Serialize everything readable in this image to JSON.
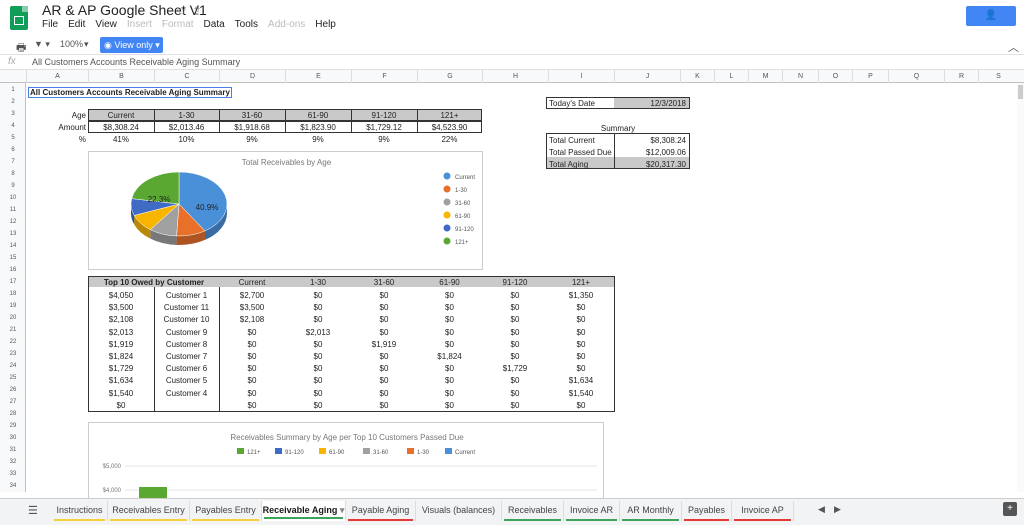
{
  "app": {
    "title": "AR & AP Google Sheet V1",
    "share_label": "SHARE",
    "menus": [
      "File",
      "Edit",
      "View",
      "Insert",
      "Format",
      "Data",
      "Tools",
      "Add-ons",
      "Help"
    ],
    "disabled_menus": [
      "Insert",
      "Format",
      "Add-ons"
    ]
  },
  "toolbar": {
    "zoom": "100%",
    "view_only": "View only"
  },
  "formula": {
    "fx": "fx",
    "text": "All Customers Accounts Receivable Aging Summary"
  },
  "columns": [
    "A",
    "B",
    "C",
    "D",
    "E",
    "F",
    "G",
    "H",
    "I",
    "J",
    "K",
    "L",
    "M",
    "N",
    "O",
    "P",
    "Q",
    "R",
    "S"
  ],
  "rows": [
    "1",
    "2",
    "3",
    "4",
    "5",
    "6",
    "7",
    "8",
    "9",
    "10",
    "11",
    "12",
    "13",
    "14",
    "15",
    "16",
    "17",
    "18",
    "19",
    "20",
    "21",
    "22",
    "23",
    "24",
    "25",
    "26",
    "27",
    "28",
    "29",
    "30",
    "31",
    "32",
    "33",
    "34"
  ],
  "sheet": {
    "heading": "All Customers Accounts Receivable Aging Summary",
    "age_label": "Age",
    "amount_label": "Amount",
    "pct_label": "%",
    "age_headers": [
      "Current",
      "1-30",
      "31-60",
      "61-90",
      "91-120",
      "121+"
    ],
    "amounts": [
      "$8,308.24",
      "$2,013.46",
      "$1,918.68",
      "$1,823.90",
      "$1,729.12",
      "$4,523.90"
    ],
    "percents": [
      "41%",
      "10%",
      "9%",
      "9%",
      "9%",
      "22%"
    ],
    "todays_date_label": "Today's Date",
    "todays_date": "12/3/2018",
    "summary_title": "Summary",
    "summary": [
      {
        "label": "Total Current",
        "value": "$8,308.24"
      },
      {
        "label": "Total Passed Due",
        "value": "$12,009.06"
      },
      {
        "label": "Total Aging",
        "value": "$20,317.30"
      }
    ],
    "top10_header": "Top 10 Owed by Customer",
    "top10_cols": [
      "Current",
      "1-30",
      "31-60",
      "61-90",
      "91-120",
      "121+"
    ],
    "top10": [
      [
        "$4,050",
        "Customer 1",
        "$2,700",
        "$0",
        "$0",
        "$0",
        "$0",
        "$1,350"
      ],
      [
        "$3,500",
        "Customer 11",
        "$3,500",
        "$0",
        "$0",
        "$0",
        "$0",
        "$0"
      ],
      [
        "$2,108",
        "Customer 10",
        "$2,108",
        "$0",
        "$0",
        "$0",
        "$0",
        "$0"
      ],
      [
        "$2,013",
        "Customer 9",
        "$0",
        "$2,013",
        "$0",
        "$0",
        "$0",
        "$0"
      ],
      [
        "$1,919",
        "Customer 8",
        "$0",
        "$0",
        "$1,919",
        "$0",
        "$0",
        "$0"
      ],
      [
        "$1,824",
        "Customer 7",
        "$0",
        "$0",
        "$0",
        "$1,824",
        "$0",
        "$0"
      ],
      [
        "$1,729",
        "Customer 6",
        "$0",
        "$0",
        "$0",
        "$0",
        "$1,729",
        "$0"
      ],
      [
        "$1,634",
        "Customer 5",
        "$0",
        "$0",
        "$0",
        "$0",
        "$0",
        "$1,634"
      ],
      [
        "$1,540",
        "Customer 4",
        "$0",
        "$0",
        "$0",
        "$0",
        "$0",
        "$1,540"
      ],
      [
        "$0",
        "",
        "$0",
        "$0",
        "$0",
        "$0",
        "$0",
        "$0"
      ]
    ]
  },
  "chart_data": [
    {
      "type": "pie",
      "title": "Total Receivables by Age",
      "categories": [
        "Current",
        "1-30",
        "31-60",
        "61-90",
        "91-120",
        "121+"
      ],
      "values": [
        40.9,
        9.9,
        9.4,
        9.0,
        8.5,
        22.3
      ],
      "slice_labels": [
        "40.9%",
        "22.3%"
      ],
      "colors": [
        "#4a90d9",
        "#e8702a",
        "#a0a0a0",
        "#f7b500",
        "#3f6bc4",
        "#5aa832"
      ],
      "legend": "right"
    },
    {
      "type": "bar",
      "title": "Receivables Summary by Age per Top 10 Customers Passed Due",
      "legend_entries": [
        "121+",
        "91-120",
        "61-90",
        "31-60",
        "1-30",
        "Current"
      ],
      "colors": [
        "#5aa832",
        "#3f6bc4",
        "#f7b500",
        "#a0a0a0",
        "#e8702a",
        "#4a90d9"
      ],
      "y_ticks": [
        "$5,000",
        "$4,000"
      ],
      "ylim": [
        0,
        5000
      ]
    }
  ],
  "tabs": [
    {
      "label": "Instructions",
      "color": "#f4d03f"
    },
    {
      "label": "Receivables Entry",
      "color": "#f4d03f"
    },
    {
      "label": "Payables Entry",
      "color": "#f4d03f"
    },
    {
      "label": "Receivable Aging",
      "color": "#3ba55c",
      "active": true
    },
    {
      "label": "Payable Aging",
      "color": "#e53935"
    },
    {
      "label": "Visuals (balances)",
      "color": ""
    },
    {
      "label": "Receivables",
      "color": "#3ba55c"
    },
    {
      "label": "Invoice AR",
      "color": "#3ba55c"
    },
    {
      "label": "AR Monthly",
      "color": "#3ba55c"
    },
    {
      "label": "Payables",
      "color": "#e53935"
    },
    {
      "label": "Invoice AP",
      "color": "#e53935"
    }
  ]
}
